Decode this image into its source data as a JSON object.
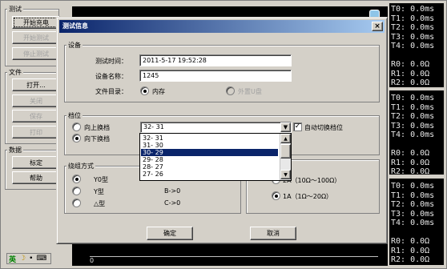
{
  "left_panel": {
    "test_group": {
      "title": "测试",
      "buttons": [
        {
          "label": "开始充电",
          "enabled": true
        },
        {
          "label": "开始测试",
          "enabled": false
        },
        {
          "label": "停止测试",
          "enabled": false
        }
      ]
    },
    "file_group": {
      "title": "文件",
      "buttons": [
        {
          "label": "打开...",
          "enabled": true
        },
        {
          "label": "关闭",
          "enabled": false
        },
        {
          "label": "保存",
          "enabled": false
        },
        {
          "label": "打印",
          "enabled": false
        }
      ]
    },
    "data_group": {
      "title": "数据",
      "buttons": [
        {
          "label": "标定",
          "enabled": true
        },
        {
          "label": "帮助",
          "enabled": true
        }
      ]
    },
    "ime": {
      "lang": "英",
      "punct": "•",
      "symbol": "⌨"
    }
  },
  "readouts": {
    "block1": "T0: 0.0ms\nT1: 0.0ms\nT2: 0.0ms\nT3: 0.0ms\nT4: 0.0ms\n\nR0: 0.0Ω\nR1: 0.0Ω\nR2: 0.0Ω",
    "block2": "T0: 0.0ms\nT1: 0.0ms\nT2: 0.0ms\nT3: 0.0ms\nT4: 0.0ms\n\nR0: 0.0Ω\nR1: 0.0Ω\nR2: 0.0Ω",
    "block3": "T0: 0.0ms\nT1: 0.0ms\nT2: 0.0ms\nT3: 0.0ms\nT4: 0.0ms\n\nR0: 0.0Ω\nR1: 0.0Ω\nR2: 0.0Ω",
    "graph_axis_zero": "0"
  },
  "dialog": {
    "title": "测试信息",
    "close": "×",
    "device_group": {
      "title": "设备",
      "test_time_label": "测试时间：",
      "test_time_value": "2011-5-17 19:52:28",
      "device_name_label": "设备名称：",
      "device_name_value": "1245",
      "file_dir_label": "文件目录：",
      "memory_label": "内存",
      "usb_label": "外置U盘"
    },
    "tap_group": {
      "title": "档位",
      "up_label": "向上换档",
      "down_label": "向下换档",
      "selected": "32- 31",
      "auto_switch_label": "自动切换档位",
      "options": [
        "32- 31",
        "31- 30",
        "30- 29",
        "29- 28",
        "28- 27",
        "27- 26"
      ],
      "highlighted_index": 2
    },
    "winding_group": {
      "title": "绕组方式",
      "options": [
        {
          "label": "Y0型",
          "value": ""
        },
        {
          "label": "Y型",
          "value": "B->0"
        },
        {
          "label": "△型",
          "value": "C->0"
        }
      ]
    },
    "current_group": {
      "options": [
        {
          "label": "2A（10Ω～100Ω）"
        },
        {
          "label": "1A（1Ω～20Ω）"
        }
      ]
    },
    "ok_label": "确定",
    "cancel_label": "取消"
  }
}
